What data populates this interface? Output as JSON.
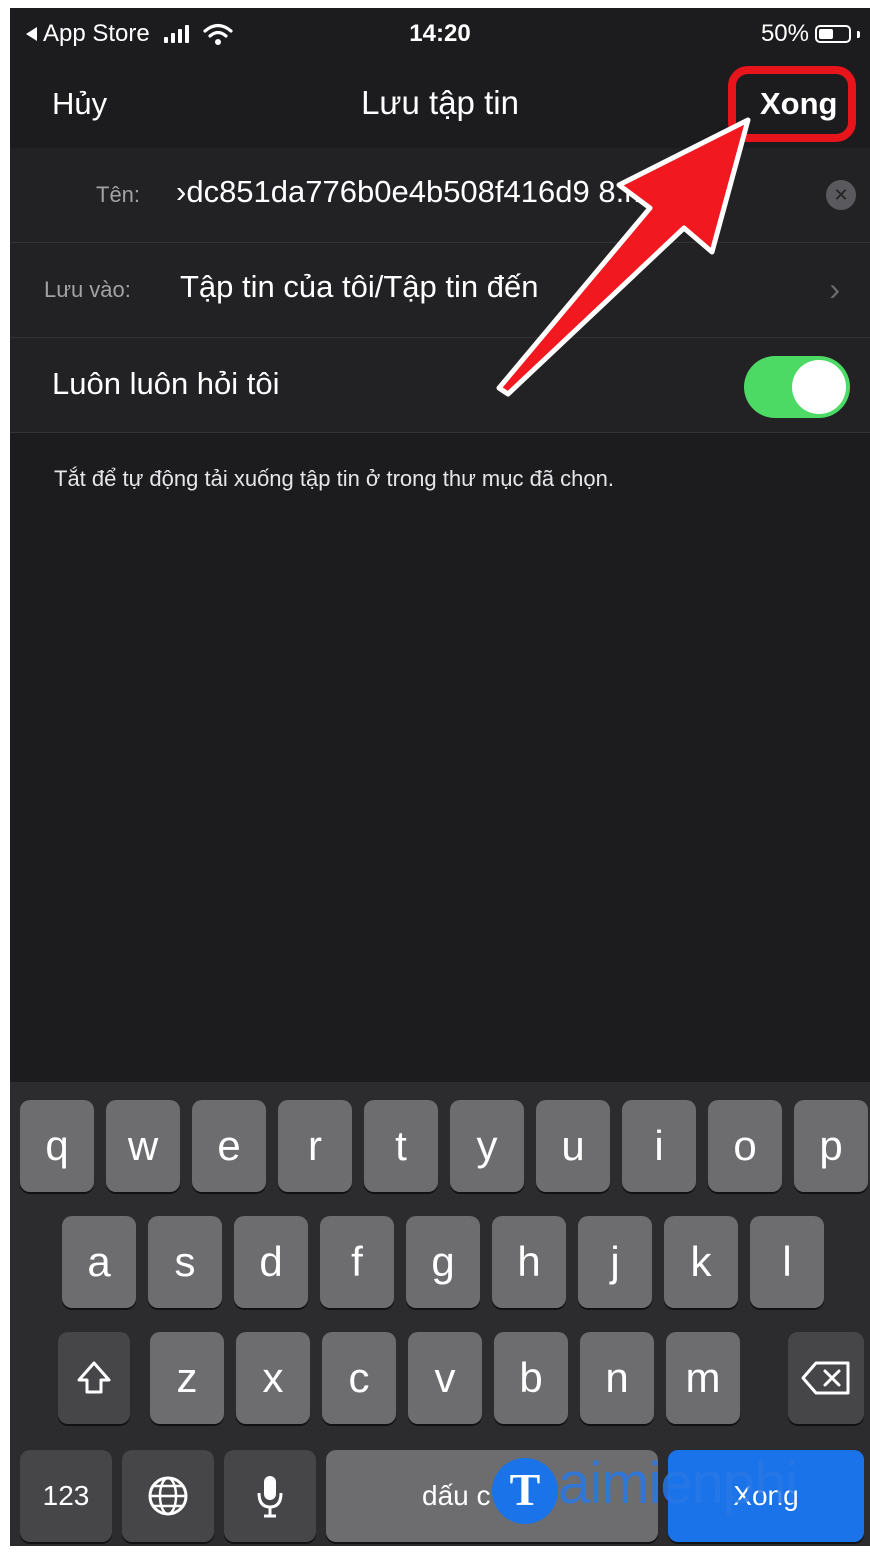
{
  "status_bar": {
    "back_app": "App Store",
    "time": "14:20",
    "battery_pct": "50%",
    "battery_level": 0.5
  },
  "nav": {
    "cancel": "Hủy",
    "title": "Lưu tập tin",
    "done": "Xong"
  },
  "form": {
    "name_label": "Tên:",
    "name_value": "›dc851da776b0e4b508f416d9      8.mp4",
    "save_label": "Lưu vào:",
    "save_value": "Tập tin của tôi/Tập tin đến",
    "always_ask_label": "Luôn luôn hỏi tôi",
    "always_ask_on": true,
    "footnote": "Tắt để tự động tải xuống tập tin ở trong thư mục đã chọn."
  },
  "keyboard": {
    "row1": [
      "q",
      "w",
      "e",
      "r",
      "t",
      "y",
      "u",
      "i",
      "o",
      "p"
    ],
    "row2": [
      "a",
      "s",
      "d",
      "f",
      "g",
      "h",
      "j",
      "k",
      "l"
    ],
    "row3": [
      "z",
      "x",
      "c",
      "v",
      "b",
      "n",
      "m"
    ],
    "numbers": "123",
    "space": "dấu c",
    "done": "Xong"
  },
  "watermark": {
    "logo_letter": "T",
    "brand": "aimienphi",
    "domain": ".vn"
  },
  "colors": {
    "background": "#1c1c1e",
    "toggle_on": "#4cd964",
    "highlight": "#e8141c",
    "done_key": "#1a73e8"
  },
  "icons": [
    "back-triangle-icon",
    "signal-icon",
    "wifi-icon",
    "battery-icon",
    "clear-icon",
    "chevron-right-icon",
    "shift-icon",
    "backspace-icon",
    "globe-icon",
    "microphone-icon",
    "red-arrow-icon"
  ]
}
